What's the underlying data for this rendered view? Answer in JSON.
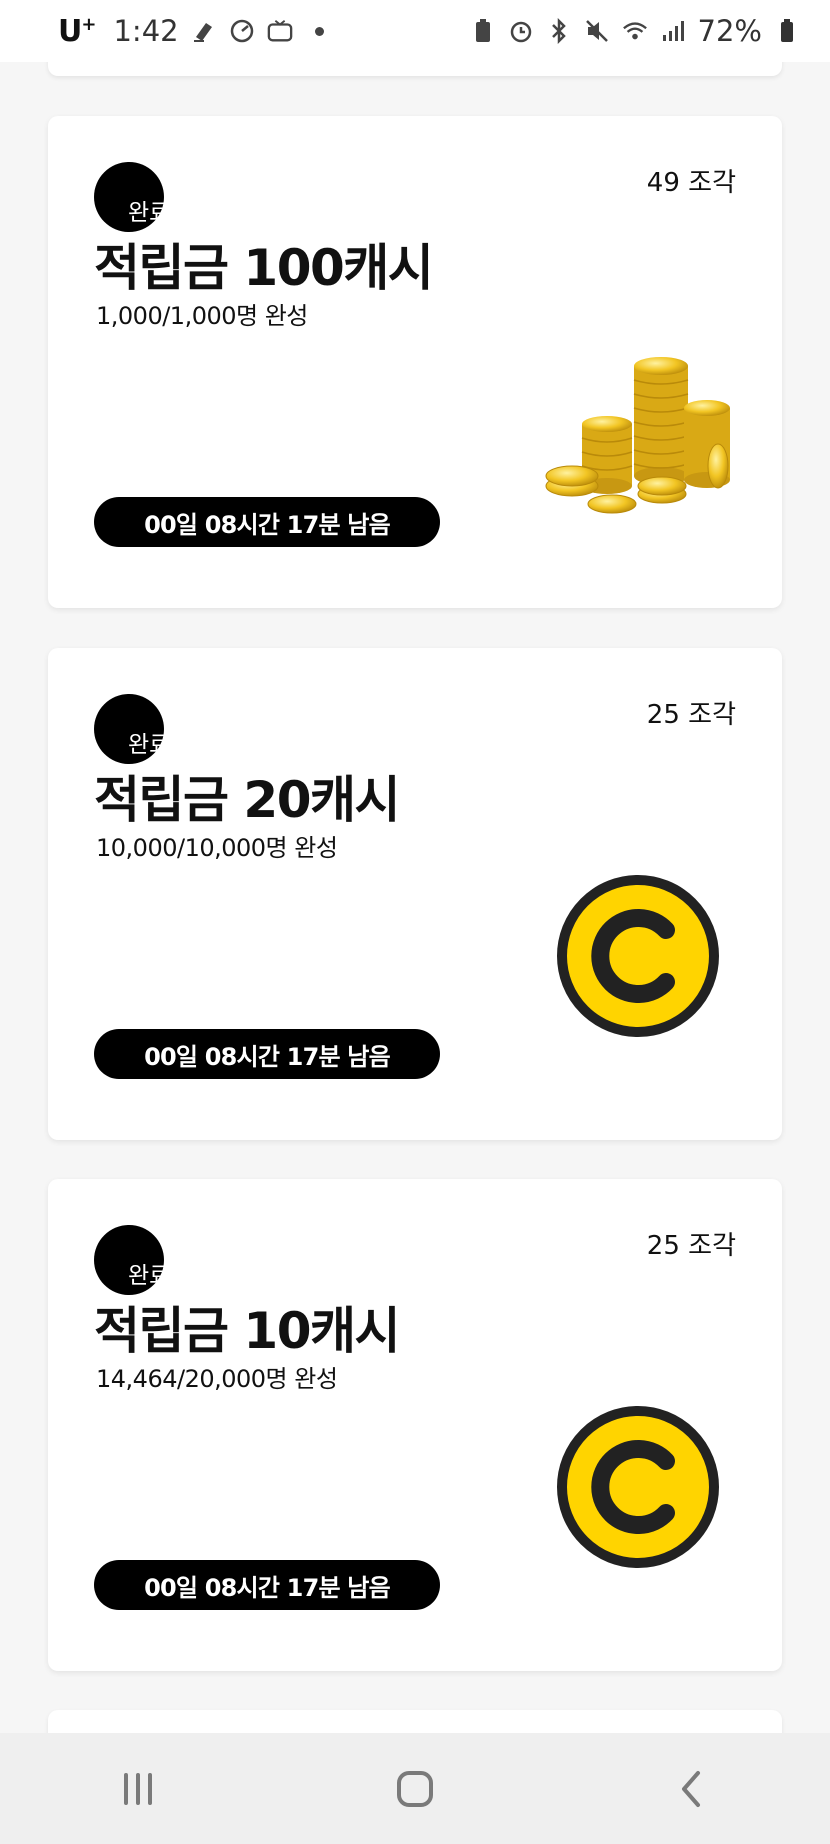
{
  "status": {
    "carrier": "U",
    "carrier_sup": "+",
    "time": "1:42",
    "battery": "72%",
    "icons": [
      "eraser-icon",
      "gauge-icon",
      "cash-tv-icon",
      "battery-saver-icon",
      "alarm-icon",
      "bluetooth-icon",
      "mute-icon",
      "wifi-icon",
      "signal-icon",
      "battery-icon"
    ]
  },
  "cards": [
    {
      "badge": "완료",
      "pieces": "49 조각",
      "title": "적립금 100캐시",
      "progress": "1,000/1,000명 완성",
      "timer": "00일 08시간 17분 남음",
      "art": "coin-stack-image"
    },
    {
      "badge": "완료",
      "pieces": "25 조각",
      "title": "적립금 20캐시",
      "progress": "10,000/10,000명 완성",
      "timer": "00일 08시간 17분 남음",
      "art": "cash-coin-icon"
    },
    {
      "badge": "완료",
      "pieces": "25 조각",
      "title": "적립금 10캐시",
      "progress": "14,464/20,000명 완성",
      "timer": "00일 08시간 17분 남음",
      "art": "cash-coin-icon"
    }
  ],
  "colors": {
    "coin_yellow": "#FFD400",
    "gold": "#E7B719",
    "badge": "#000000"
  },
  "nav": [
    "recent-apps-icon",
    "home-icon",
    "back-icon"
  ]
}
